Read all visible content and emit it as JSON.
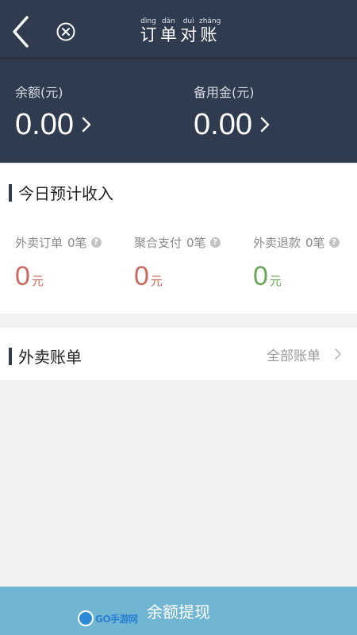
{
  "header": {
    "title_pinyin": [
      "dìng",
      "dān",
      "duì",
      "zhàng"
    ],
    "title_chars": [
      "订",
      "单",
      "对",
      "账"
    ],
    "back_icon": "chevron-left-icon",
    "close_icon": "close-circle-icon"
  },
  "balances": {
    "balance_label": "余额(元)",
    "balance_value": "0.00",
    "reserve_label": "备用金(元)",
    "reserve_value": "0.00"
  },
  "income": {
    "section_title": "今日预计收入",
    "stats": [
      {
        "label": "外卖订单",
        "count": "0笔",
        "amount": "0",
        "unit": "元",
        "color": "#c96a60"
      },
      {
        "label": "聚合支付",
        "count": "0笔",
        "amount": "0",
        "unit": "元",
        "color": "#c96a60"
      },
      {
        "label": "外卖退款",
        "count": "0笔",
        "amount": "0",
        "unit": "元",
        "color": "#6aa75a"
      }
    ]
  },
  "bills": {
    "section_title": "外卖账单",
    "all_bills_label": "全部账单"
  },
  "footer": {
    "withdraw_label": "余额提现",
    "watermark_text": "GO手游网"
  },
  "colors": {
    "header_bg": "#2f3b4e",
    "button_bg": "#70b6d3"
  }
}
